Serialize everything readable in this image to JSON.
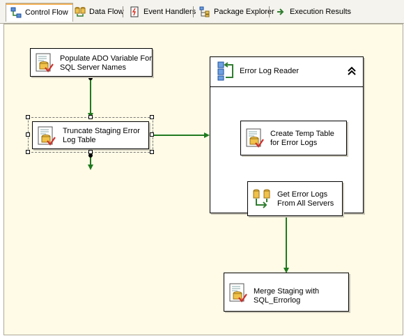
{
  "tabs": [
    {
      "label": "Control Flow",
      "icon": "control-flow-icon",
      "active": true
    },
    {
      "label": "Data Flow",
      "icon": "data-flow-icon"
    },
    {
      "label": "Event Handlers",
      "icon": "event-handlers-icon"
    },
    {
      "label": "Package Explorer",
      "icon": "package-explorer-icon"
    },
    {
      "label": "Execution Results",
      "icon": "execution-results-icon"
    }
  ],
  "tasks": {
    "populate": {
      "line1": "Populate ADO Variable For",
      "line2": "SQL Server Names",
      "icon": "execute-sql-task-icon"
    },
    "truncate": {
      "line1": "Truncate Staging Error",
      "line2": "Log Table",
      "icon": "execute-sql-task-icon"
    },
    "create_temp": {
      "line1": "Create Temp Table",
      "line2": "for Error Logs",
      "icon": "execute-sql-task-icon"
    },
    "get_logs": {
      "line1": "Get Error Logs",
      "line2": "From All Servers",
      "icon": "data-flow-task-icon"
    },
    "merge": {
      "line1": "Merge Staging with",
      "line2": "SQL_Errorlog",
      "icon": "execute-sql-task-icon"
    }
  },
  "container": {
    "title": "Error Log Reader",
    "icon": "foreach-loop-icon",
    "collapse_icon": "collapse-chevron-icon"
  },
  "colors": {
    "canvas_bg": "#fffbe6",
    "precedence_success": "#1f7a1f",
    "tab_strip": "#f4f3ee",
    "active_tab_accent": "#f4b35a"
  }
}
